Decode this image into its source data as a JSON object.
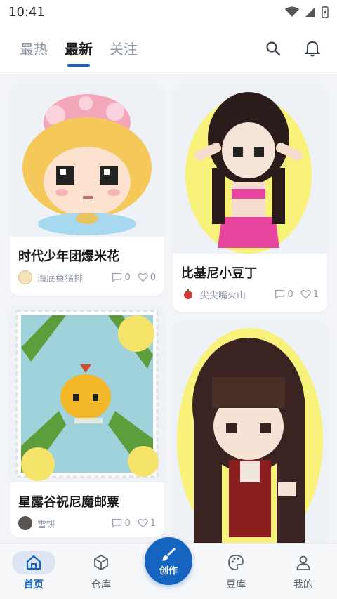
{
  "status_bar": {
    "time": "10:41"
  },
  "tabs": [
    {
      "label": "最热"
    },
    {
      "label": "最新"
    },
    {
      "label": "关注"
    }
  ],
  "feed": {
    "cards": [
      {
        "title": "时代少年团爆米花",
        "author": "海底鱼猪排",
        "comments": "0",
        "likes": "0"
      },
      {
        "title": "比基尼小豆丁",
        "author": "尖尖嘴火山",
        "comments": "0",
        "likes": "1"
      },
      {
        "title": "星露谷祝尼魔邮票",
        "author": "雪饼",
        "comments": "0",
        "likes": "1"
      }
    ]
  },
  "bottom_nav": {
    "items": [
      {
        "label": "首页"
      },
      {
        "label": "仓库"
      },
      {
        "label": "豆库"
      },
      {
        "label": "我的"
      }
    ],
    "create_label": "创作"
  },
  "colors": {
    "accent": "#1565c0",
    "inactive_tab": "#8e98a8",
    "feed_bg": "#f2f4f8"
  }
}
